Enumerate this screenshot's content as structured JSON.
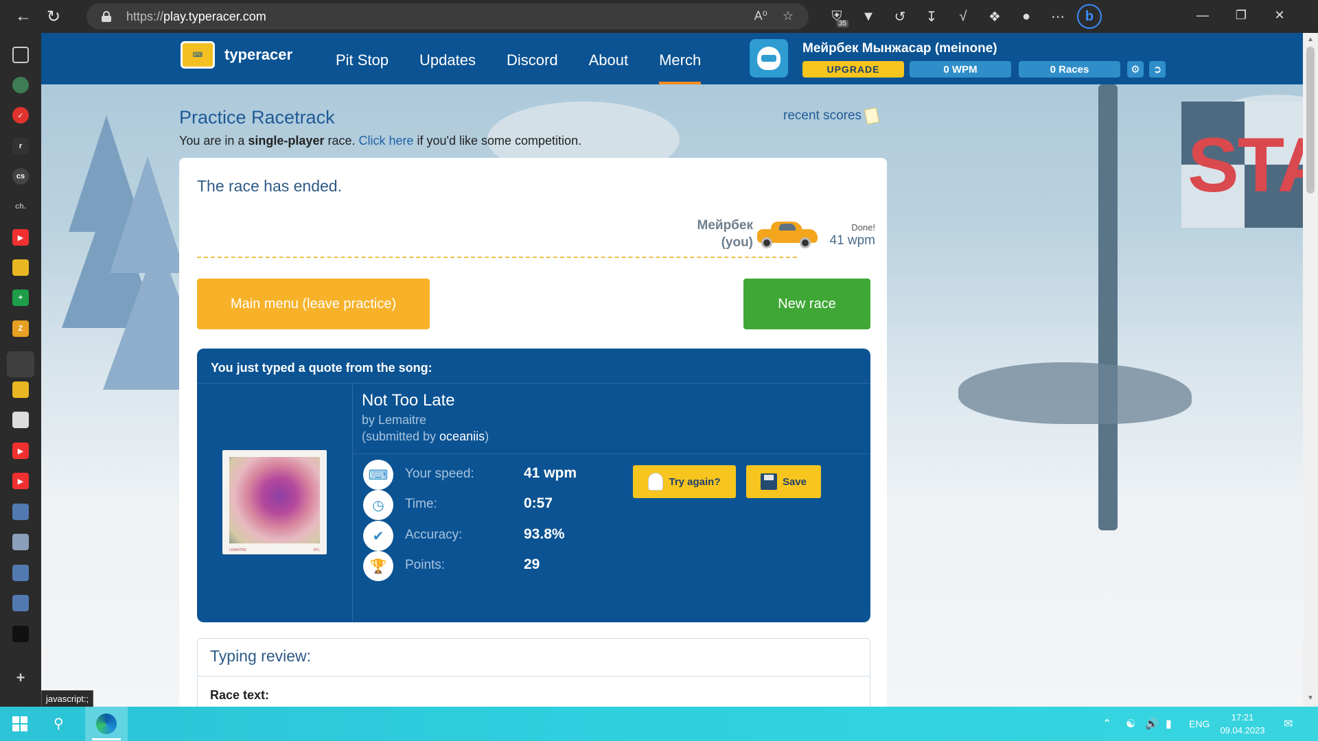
{
  "browser": {
    "url_prefix": "https://",
    "url_domain": "play.typeracer.com",
    "extension_badge": "35",
    "tooltip": "javascript:;"
  },
  "site": {
    "logo_text": "typeracer",
    "nav": [
      "Pit Stop",
      "Updates",
      "Discord",
      "About",
      "Merch"
    ],
    "active_nav": "Merch",
    "user": {
      "name": "Мейрбек Мынжасар (meinone)",
      "upgrade_label": "UPGRADE",
      "wpm_label": "0  WPM",
      "races_label": "0 Races"
    }
  },
  "practice": {
    "title": "Practice Racetrack",
    "sub_prefix": "You are in a ",
    "sub_bold": "single-player",
    "sub_middle": " race. ",
    "sub_link": "Click here",
    "sub_suffix": " if you'd like some competition.",
    "recent_scores": "recent scores"
  },
  "race": {
    "ended_title": "The race has ended.",
    "racer_name": "Мейрбек",
    "racer_you": "(you)",
    "done_label": "Done!",
    "done_wpm": "41 wpm",
    "main_menu_button": "Main menu (leave practice)",
    "new_race_button": "New race"
  },
  "quote": {
    "header": "You just typed a quote from the song:",
    "song_title": "Not Too Late",
    "song_artist": "by Lemaitre",
    "submitted_prefix": "(submitted by ",
    "submitted_user": "oceaniis",
    "submitted_suffix": ")",
    "album_caption_left": "LEMAITRE",
    "album_caption_right": "NTL",
    "stats": [
      {
        "label": "Your speed:",
        "value": "41 wpm",
        "icon": "keyboard-icon"
      },
      {
        "label": "Time:",
        "value": "0:57",
        "icon": "clock-icon"
      },
      {
        "label": "Accuracy:",
        "value": "93.8%",
        "icon": "checkmark-icon"
      },
      {
        "label": "Points:",
        "value": "29",
        "icon": "trophy-icon"
      }
    ],
    "try_again_button": "Try again?",
    "save_button": "Save"
  },
  "review": {
    "title": "Typing review:",
    "race_text_label": "Race text:"
  },
  "taskbar": {
    "language": "ENG",
    "time": "17:21",
    "date": "09.04.2023"
  },
  "colors": {
    "header_blue": "#0b5393",
    "accent_orange": "#f48c1e",
    "button_orange": "#f7b22a",
    "button_green": "#3fa736",
    "button_yellow": "#f7c51d"
  }
}
